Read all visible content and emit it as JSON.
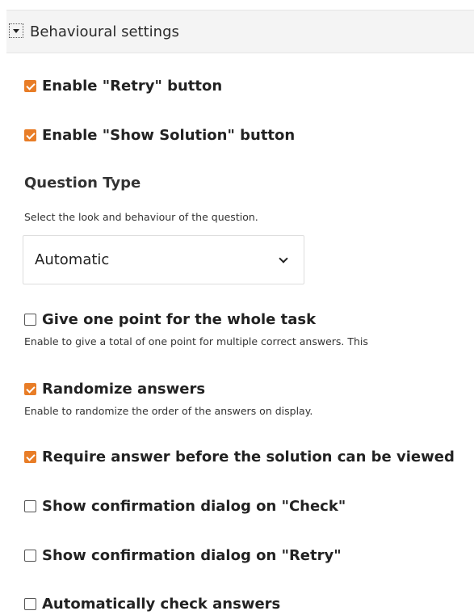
{
  "section": {
    "title": "Behavioural settings",
    "expanded": true
  },
  "options": {
    "retry": {
      "label": "Enable \"Retry\" button",
      "checked": true
    },
    "show_solution": {
      "label": "Enable \"Show Solution\" button",
      "checked": true
    }
  },
  "question_type": {
    "title": "Question Type",
    "description": "Select the look and behaviour of the question.",
    "selected": "Automatic"
  },
  "settings": {
    "single_point": {
      "label": "Give one point for the whole task",
      "description": "Enable to give a total of one point for multiple correct answers. This",
      "checked": false
    },
    "randomize": {
      "label": "Randomize answers",
      "description": "Enable to randomize the order of the answers on display.",
      "checked": true
    },
    "require_answer": {
      "label": "Require answer before the solution can be viewed",
      "checked": true
    },
    "confirm_check": {
      "label": "Show confirmation dialog on \"Check\"",
      "checked": false
    },
    "confirm_retry": {
      "label": "Show confirmation dialog on \"Retry\"",
      "checked": false
    },
    "auto_check": {
      "label": "Automatically check answers",
      "checked": false
    }
  },
  "colors": {
    "accent": "#e87d27",
    "header_bg": "#f4f4f4"
  }
}
